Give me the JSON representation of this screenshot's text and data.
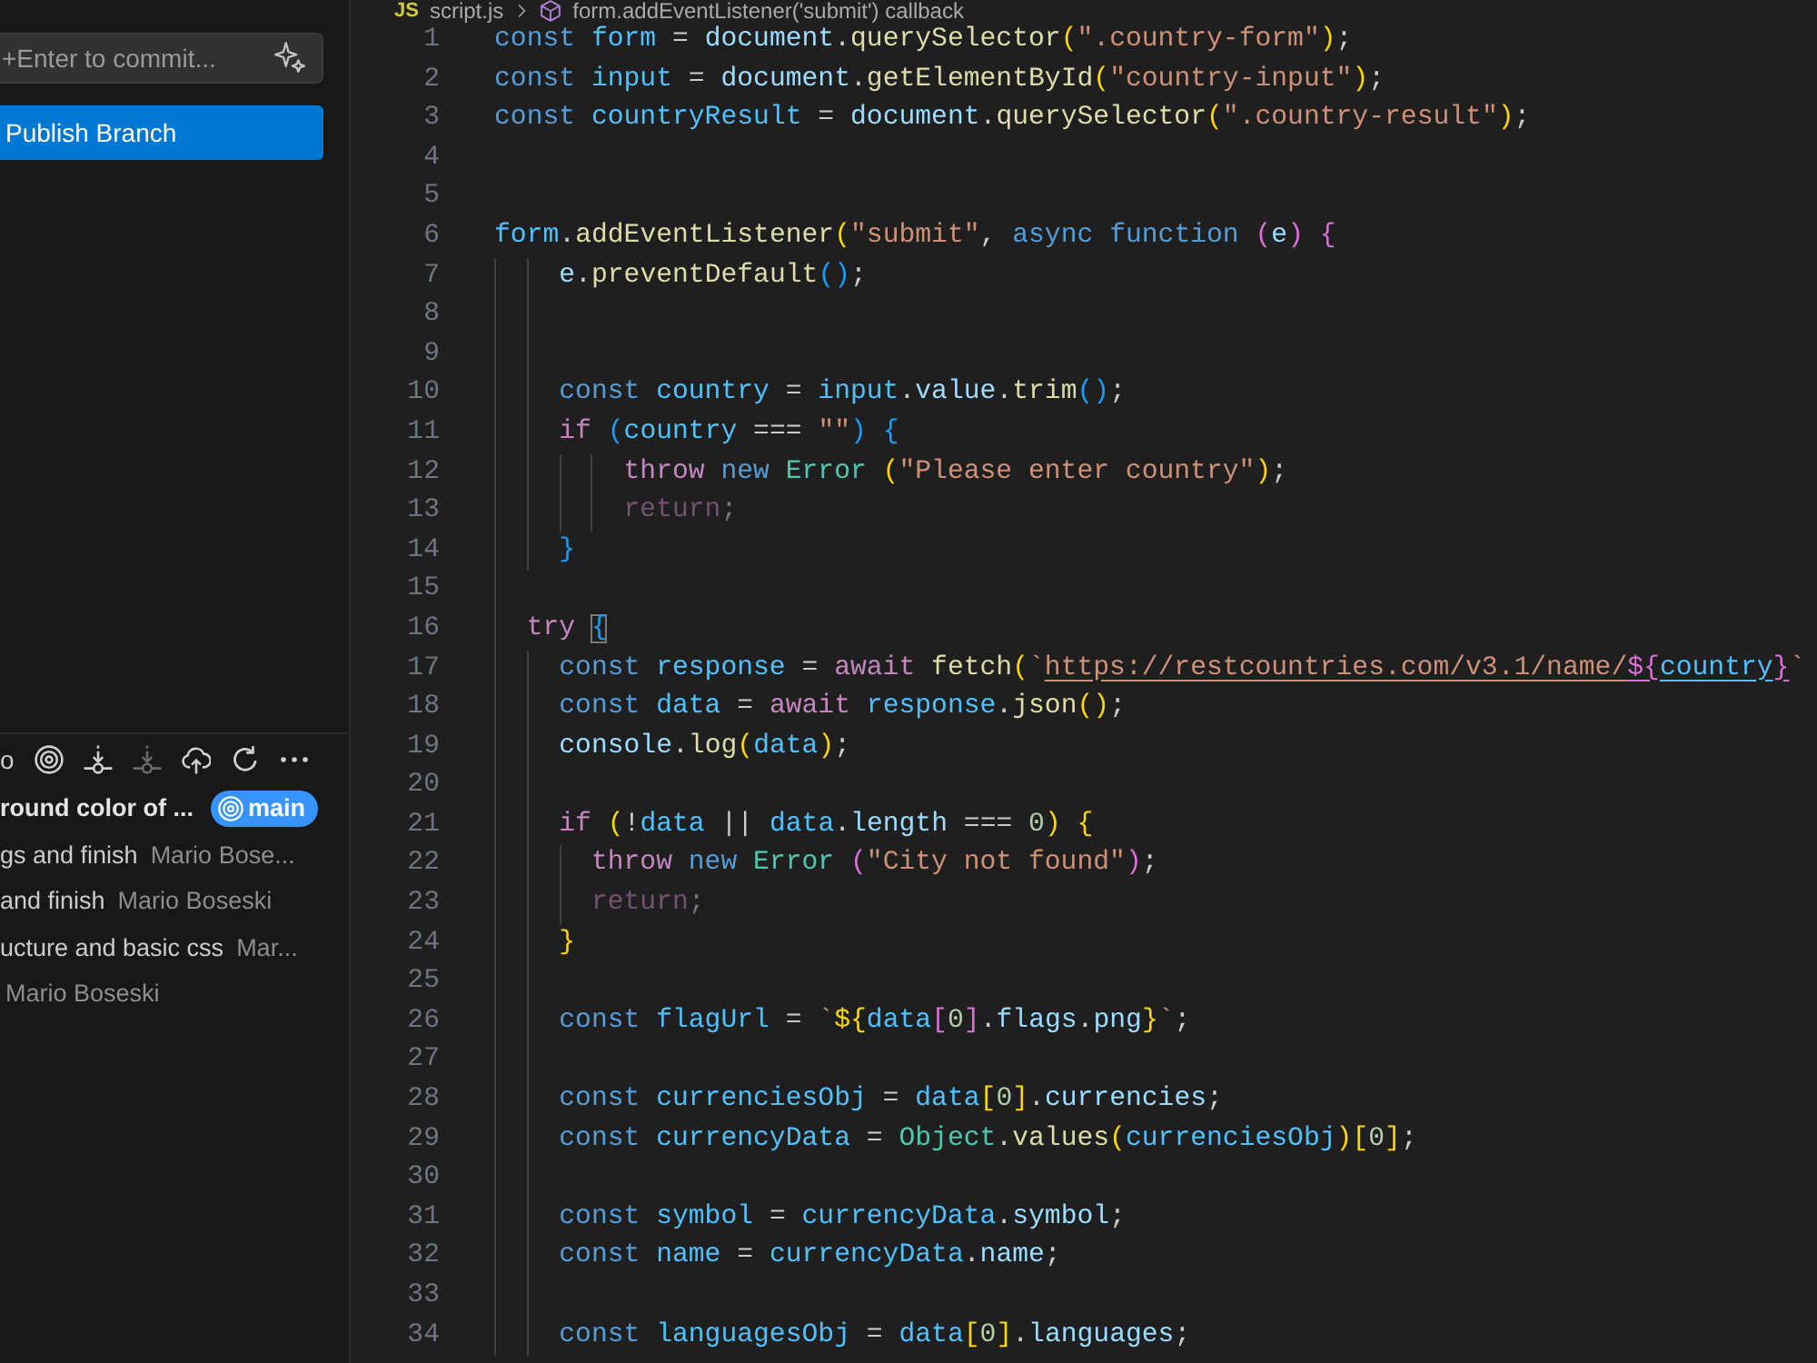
{
  "source_control": {
    "commit_field": {
      "placeholder": "+Enter to commit..."
    },
    "publish_button": "Publish Branch"
  },
  "graph": {
    "label": "o",
    "toolbar": [
      {
        "kind": "target",
        "disabled": false
      },
      {
        "kind": "fetch",
        "disabled": false
      },
      {
        "kind": "pull",
        "disabled": true
      },
      {
        "kind": "push",
        "disabled": false
      },
      {
        "kind": "refresh",
        "disabled": false
      },
      {
        "kind": "more",
        "disabled": false
      }
    ],
    "commits": [
      {
        "message": "round color of ...",
        "branch": "main",
        "head": true
      },
      {
        "message": "gs and finish",
        "author": "Mario Bose...",
        "head": false
      },
      {
        "message": "and finish",
        "author": "Mario Boseski",
        "head": false
      },
      {
        "message": "ucture and basic css",
        "author": "Mar...",
        "head": false
      },
      {
        "author": "Mario Boseski",
        "head": false
      }
    ]
  },
  "editor": {
    "breadcrumb": {
      "file_type": "JS",
      "file": "script.js",
      "symbol": "form.addEventListener('submit') callback"
    },
    "lines": [
      {
        "number": "1",
        "tokens": [
          {
            "kind": "keyword",
            "text": "const"
          },
          {
            "kind": "constant",
            "text": " form"
          },
          {
            "kind": "plain",
            "text": " = "
          },
          {
            "kind": "variable",
            "text": "document"
          },
          {
            "kind": "plain",
            "text": "."
          },
          {
            "kind": "function",
            "text": "querySelector"
          },
          {
            "kind": "bracket1",
            "text": "("
          },
          {
            "kind": "string",
            "text": "\".country-form\""
          },
          {
            "kind": "bracket1",
            "text": ")"
          },
          {
            "kind": "plain",
            "text": ";"
          }
        ]
      },
      {
        "number": "2",
        "tokens": [
          {
            "kind": "keyword",
            "text": "const"
          },
          {
            "kind": "constant",
            "text": " input"
          },
          {
            "kind": "plain",
            "text": " = "
          },
          {
            "kind": "variable",
            "text": "document"
          },
          {
            "kind": "plain",
            "text": "."
          },
          {
            "kind": "function",
            "text": "getElementById"
          },
          {
            "kind": "bracket1",
            "text": "("
          },
          {
            "kind": "string",
            "text": "\"country-input\""
          },
          {
            "kind": "bracket1",
            "text": ")"
          },
          {
            "kind": "plain",
            "text": ";"
          }
        ]
      },
      {
        "number": "3",
        "tokens": [
          {
            "kind": "keyword",
            "text": "const"
          },
          {
            "kind": "constant",
            "text": " countryResult"
          },
          {
            "kind": "plain",
            "text": " = "
          },
          {
            "kind": "variable",
            "text": "document"
          },
          {
            "kind": "plain",
            "text": "."
          },
          {
            "kind": "function",
            "text": "querySelector"
          },
          {
            "kind": "bracket1",
            "text": "("
          },
          {
            "kind": "string",
            "text": "\".country-result\""
          },
          {
            "kind": "bracket1",
            "text": ")"
          },
          {
            "kind": "plain",
            "text": ";"
          }
        ]
      },
      {
        "number": "4"
      },
      {
        "number": "5"
      },
      {
        "number": "6",
        "tokens": [
          {
            "kind": "constant",
            "text": "form"
          },
          {
            "kind": "plain",
            "text": "."
          },
          {
            "kind": "function",
            "text": "addEventListener"
          },
          {
            "kind": "bracket1",
            "text": "("
          },
          {
            "kind": "string",
            "text": "\"submit\""
          },
          {
            "kind": "plain",
            "text": ", "
          },
          {
            "kind": "keyword",
            "text": "async"
          },
          {
            "kind": "keyword",
            "text": " function "
          },
          {
            "kind": "bracket2",
            "text": "("
          },
          {
            "kind": "variable",
            "text": "e"
          },
          {
            "kind": "bracket2",
            "text": ")"
          },
          {
            "kind": "bracket2",
            "text": " {"
          }
        ]
      },
      {
        "number": "7",
        "tokens": [
          {
            "kind": "variable",
            "text": "    e"
          },
          {
            "kind": "plain",
            "text": "."
          },
          {
            "kind": "function",
            "text": "preventDefault"
          },
          {
            "kind": "bracket3",
            "text": "()"
          },
          {
            "kind": "plain",
            "text": ";"
          }
        ]
      },
      {
        "number": "8"
      },
      {
        "number": "9"
      },
      {
        "number": "10",
        "tokens": [
          {
            "kind": "keyword",
            "text": "    const"
          },
          {
            "kind": "constant",
            "text": " country"
          },
          {
            "kind": "plain",
            "text": " = "
          },
          {
            "kind": "constant",
            "text": "input"
          },
          {
            "kind": "plain",
            "text": "."
          },
          {
            "kind": "variable",
            "text": "value"
          },
          {
            "kind": "plain",
            "text": "."
          },
          {
            "kind": "function",
            "text": "trim"
          },
          {
            "kind": "bracket3",
            "text": "()"
          },
          {
            "kind": "plain",
            "text": ";"
          }
        ]
      },
      {
        "number": "11",
        "tokens": [
          {
            "kind": "control",
            "text": "    if"
          },
          {
            "kind": "bracket3",
            "text": " ("
          },
          {
            "kind": "constant",
            "text": "country"
          },
          {
            "kind": "plain",
            "text": " === "
          },
          {
            "kind": "string",
            "text": "\"\""
          },
          {
            "kind": "bracket3",
            "text": ")"
          },
          {
            "kind": "bracket3",
            "text": " {"
          }
        ]
      },
      {
        "number": "12",
        "tokens": [
          {
            "kind": "control",
            "text": "        throw"
          },
          {
            "kind": "keyword",
            "text": " new"
          },
          {
            "kind": "class",
            "text": " Error"
          },
          {
            "kind": "bracket1",
            "text": " ("
          },
          {
            "kind": "string",
            "text": "\"Please enter country\""
          },
          {
            "kind": "bracket1",
            "text": ")"
          },
          {
            "kind": "plain",
            "text": ";"
          }
        ]
      },
      {
        "number": "13",
        "tokens": [
          {
            "kind": "controlfaded",
            "text": "        return"
          },
          {
            "kind": "plainfaded",
            "text": ";"
          }
        ]
      },
      {
        "number": "14",
        "tokens": [
          {
            "kind": "bracket3",
            "text": "    }"
          }
        ]
      },
      {
        "number": "15"
      },
      {
        "number": "16",
        "tokens": [
          {
            "kind": "control",
            "text": "  try "
          },
          {
            "kind": "bracketmatch",
            "text": "{"
          }
        ]
      },
      {
        "number": "17",
        "tokens": [
          {
            "kind": "keyword",
            "text": "    const"
          },
          {
            "kind": "constant",
            "text": " response"
          },
          {
            "kind": "plain",
            "text": " = "
          },
          {
            "kind": "control",
            "text": "await"
          },
          {
            "kind": "function",
            "text": " fetch"
          },
          {
            "kind": "bracket1",
            "text": "("
          },
          {
            "kind": "string",
            "text": "`"
          },
          {
            "kind": "link",
            "text": "https://restcountries.com/v3.1/name/"
          },
          {
            "kind": "linkbracket2",
            "text": "${"
          },
          {
            "kind": "linkconstant",
            "text": "country"
          },
          {
            "kind": "linkbracket2",
            "text": "}"
          },
          {
            "kind": "string",
            "text": "`"
          }
        ]
      },
      {
        "number": "18",
        "tokens": [
          {
            "kind": "keyword",
            "text": "    const"
          },
          {
            "kind": "constant",
            "text": " data"
          },
          {
            "kind": "plain",
            "text": " = "
          },
          {
            "kind": "control",
            "text": "await"
          },
          {
            "kind": "constant",
            "text": " response"
          },
          {
            "kind": "plain",
            "text": "."
          },
          {
            "kind": "function",
            "text": "json"
          },
          {
            "kind": "bracket1",
            "text": "()"
          },
          {
            "kind": "plain",
            "text": ";"
          }
        ]
      },
      {
        "number": "19",
        "tokens": [
          {
            "kind": "variable",
            "text": "    console"
          },
          {
            "kind": "plain",
            "text": "."
          },
          {
            "kind": "function",
            "text": "log"
          },
          {
            "kind": "bracket1",
            "text": "("
          },
          {
            "kind": "constant",
            "text": "data"
          },
          {
            "kind": "bracket1",
            "text": ")"
          },
          {
            "kind": "plain",
            "text": ";"
          }
        ]
      },
      {
        "number": "20"
      },
      {
        "number": "21",
        "tokens": [
          {
            "kind": "control",
            "text": "    if"
          },
          {
            "kind": "bracket1",
            "text": " ("
          },
          {
            "kind": "plain",
            "text": "!"
          },
          {
            "kind": "constant",
            "text": "data"
          },
          {
            "kind": "plain",
            "text": " || "
          },
          {
            "kind": "constant",
            "text": "data"
          },
          {
            "kind": "plain",
            "text": "."
          },
          {
            "kind": "variable",
            "text": "length"
          },
          {
            "kind": "plain",
            "text": " === "
          },
          {
            "kind": "number",
            "text": "0"
          },
          {
            "kind": "bracket1",
            "text": ")"
          },
          {
            "kind": "bracket1",
            "text": " {"
          }
        ]
      },
      {
        "number": "22",
        "tokens": [
          {
            "kind": "control",
            "text": "      throw"
          },
          {
            "kind": "keyword",
            "text": " new"
          },
          {
            "kind": "class",
            "text": " Error"
          },
          {
            "kind": "bracket2",
            "text": " ("
          },
          {
            "kind": "string",
            "text": "\"City not found\""
          },
          {
            "kind": "bracket2",
            "text": ")"
          },
          {
            "kind": "plain",
            "text": ";"
          }
        ]
      },
      {
        "number": "23",
        "tokens": [
          {
            "kind": "controlfaded",
            "text": "      return"
          },
          {
            "kind": "plainfaded",
            "text": ";"
          }
        ]
      },
      {
        "number": "24",
        "tokens": [
          {
            "kind": "bracket1",
            "text": "    }"
          }
        ]
      },
      {
        "number": "25"
      },
      {
        "number": "26",
        "tokens": [
          {
            "kind": "keyword",
            "text": "    const"
          },
          {
            "kind": "constant",
            "text": " flagUrl"
          },
          {
            "kind": "plain",
            "text": " = "
          },
          {
            "kind": "string",
            "text": "`"
          },
          {
            "kind": "bracket1",
            "text": "${"
          },
          {
            "kind": "constant",
            "text": "data"
          },
          {
            "kind": "bracket2",
            "text": "["
          },
          {
            "kind": "number",
            "text": "0"
          },
          {
            "kind": "bracket2",
            "text": "]"
          },
          {
            "kind": "plain",
            "text": "."
          },
          {
            "kind": "variable",
            "text": "flags"
          },
          {
            "kind": "plain",
            "text": "."
          },
          {
            "kind": "variable",
            "text": "png"
          },
          {
            "kind": "bracket1",
            "text": "}"
          },
          {
            "kind": "string",
            "text": "`"
          },
          {
            "kind": "plain",
            "text": ";"
          }
        ]
      },
      {
        "number": "27"
      },
      {
        "number": "28",
        "tokens": [
          {
            "kind": "keyword",
            "text": "    const"
          },
          {
            "kind": "constant",
            "text": " currenciesObj"
          },
          {
            "kind": "plain",
            "text": " = "
          },
          {
            "kind": "constant",
            "text": "data"
          },
          {
            "kind": "bracket1",
            "text": "["
          },
          {
            "kind": "number",
            "text": "0"
          },
          {
            "kind": "bracket1",
            "text": "]"
          },
          {
            "kind": "plain",
            "text": "."
          },
          {
            "kind": "variable",
            "text": "currencies"
          },
          {
            "kind": "plain",
            "text": ";"
          }
        ]
      },
      {
        "number": "29",
        "tokens": [
          {
            "kind": "keyword",
            "text": "    const"
          },
          {
            "kind": "constant",
            "text": " currencyData"
          },
          {
            "kind": "plain",
            "text": " = "
          },
          {
            "kind": "class",
            "text": "Object"
          },
          {
            "kind": "plain",
            "text": "."
          },
          {
            "kind": "function",
            "text": "values"
          },
          {
            "kind": "bracket1",
            "text": "("
          },
          {
            "kind": "constant",
            "text": "currenciesObj"
          },
          {
            "kind": "bracket1",
            "text": ")"
          },
          {
            "kind": "bracket1",
            "text": "["
          },
          {
            "kind": "number",
            "text": "0"
          },
          {
            "kind": "bracket1",
            "text": "]"
          },
          {
            "kind": "plain",
            "text": ";"
          }
        ]
      },
      {
        "number": "30"
      },
      {
        "number": "31",
        "tokens": [
          {
            "kind": "keyword",
            "text": "    const"
          },
          {
            "kind": "constant",
            "text": " symbol"
          },
          {
            "kind": "plain",
            "text": " = "
          },
          {
            "kind": "constant",
            "text": "currencyData"
          },
          {
            "kind": "plain",
            "text": "."
          },
          {
            "kind": "variable",
            "text": "symbol"
          },
          {
            "kind": "plain",
            "text": ";"
          }
        ]
      },
      {
        "number": "32",
        "tokens": [
          {
            "kind": "keyword",
            "text": "    const"
          },
          {
            "kind": "constant",
            "text": " name"
          },
          {
            "kind": "plain",
            "text": " = "
          },
          {
            "kind": "constant",
            "text": "currencyData"
          },
          {
            "kind": "plain",
            "text": "."
          },
          {
            "kind": "variable",
            "text": "name"
          },
          {
            "kind": "plain",
            "text": ";"
          }
        ]
      },
      {
        "number": "33"
      },
      {
        "number": "34",
        "tokens": [
          {
            "kind": "keyword",
            "text": "    const"
          },
          {
            "kind": "constant",
            "text": " languagesObj"
          },
          {
            "kind": "plain",
            "text": " = "
          },
          {
            "kind": "constant",
            "text": "data"
          },
          {
            "kind": "bracket1",
            "text": "["
          },
          {
            "kind": "number",
            "text": "0"
          },
          {
            "kind": "bracket1",
            "text": "]"
          },
          {
            "kind": "plain",
            "text": "."
          },
          {
            "kind": "variable",
            "text": "languages"
          },
          {
            "kind": "plain",
            "text": ";"
          }
        ]
      }
    ]
  }
}
